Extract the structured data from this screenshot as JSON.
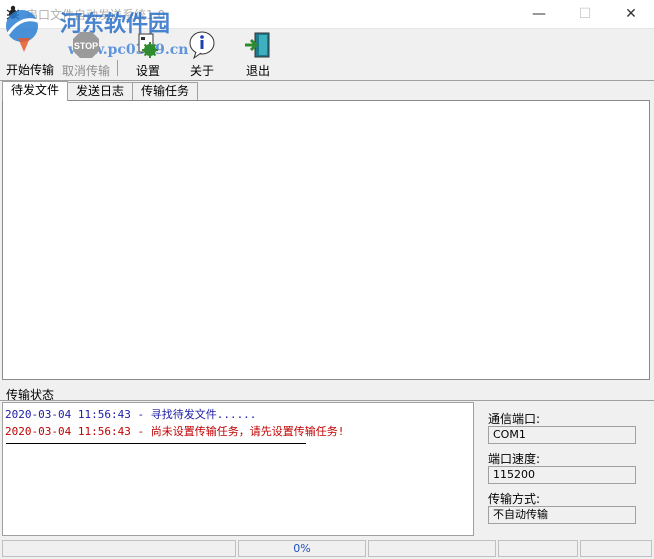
{
  "window": {
    "title": "串口文件自动发送系统1.0",
    "watermark_cn": "河东软件园",
    "watermark_url": "www.pc0359.cn"
  },
  "toolbar": {
    "start_label": "开始传输",
    "cancel_label": "取消传输",
    "settings_label": "设置",
    "about_label": "关于",
    "exit_label": "退出"
  },
  "tabs": [
    {
      "label": "待发文件"
    },
    {
      "label": "发送日志"
    },
    {
      "label": "传输任务"
    }
  ],
  "status": {
    "title": "传输状态",
    "log": [
      {
        "text": "2020-03-04 11:56:43 - 寻找待发文件......",
        "color": "#1c1ca8"
      },
      {
        "text": "2020-03-04 11:56:43 - 尚未设置传输任务，请先设置传输任务!",
        "color": "#c00000"
      }
    ],
    "port_label": "通信端口:",
    "port_value": "COM1",
    "speed_label": "端口速度:",
    "speed_value": "115200",
    "mode_label": "传输方式:",
    "mode_value": "不自动传输"
  },
  "statusbar": {
    "progress": "0%"
  }
}
